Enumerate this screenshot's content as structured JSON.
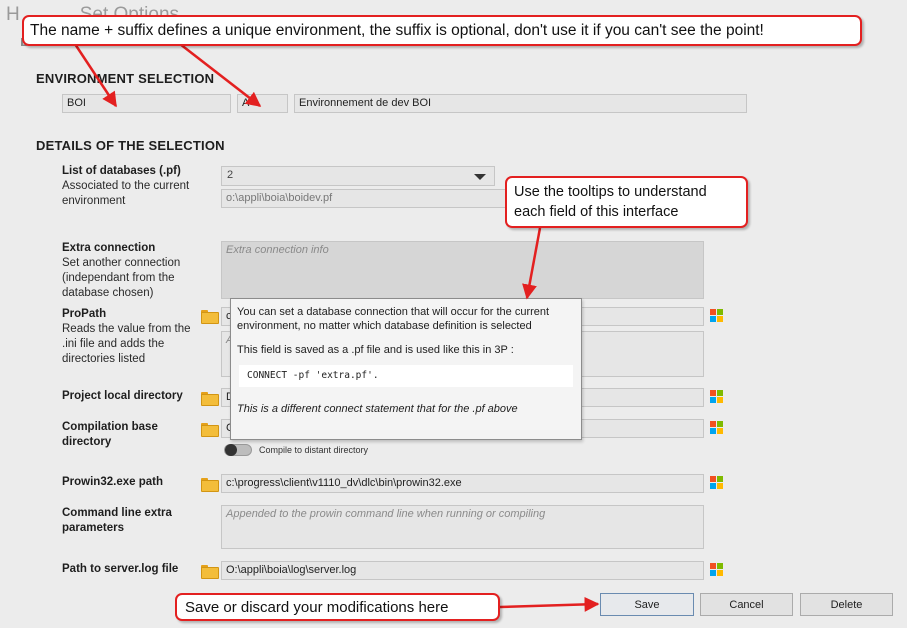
{
  "header": {
    "title": "Set Options",
    "subtitle": "ENVIRONMENT SELECTION"
  },
  "environment_selection": {
    "section_title": "ENVIRONMENT SELECTION",
    "name": "BOI",
    "suffix": "A",
    "label": "Environnement de dev BOI"
  },
  "details": {
    "section_title": "DETAILS OF THE SELECTION",
    "databases": {
      "label": "List of databases (.pf)",
      "description": "Associated to the current environment",
      "selected": "2",
      "path": "o:\\appli\\boia\\boidev.pf"
    },
    "extra_connection": {
      "label": "Extra connection",
      "description": "Set another connection (independant from the database chosen)",
      "placeholder": "Extra connection info"
    },
    "propath": {
      "label": "ProPath",
      "description": "Reads the value from the .ini file and adds the directories listed",
      "value": "c",
      "area_value": "A"
    },
    "project_local_directory": {
      "label": "Project local directory",
      "value": "D"
    },
    "compilation_base_directory": {
      "label": "Compilation base directory",
      "value": "C",
      "toggle_label": "Compile to distant directory"
    },
    "prowin32": {
      "label": "Prowin32.exe path",
      "value": "c:\\progress\\client\\v1110_dv\\dlc\\bin\\prowin32.exe"
    },
    "cmdline": {
      "label": "Command line extra parameters",
      "placeholder": "Appended to the prowin command line when running or compiling"
    },
    "serverlog": {
      "label": "Path to server.log file",
      "value": "O:\\appli\\boia\\log\\server.log"
    }
  },
  "tooltip": {
    "line1": "You can set a database connection that will occur for the current environment, no matter which database definition is selected",
    "line2": "This field is saved as a .pf file and is used like this in 3P :",
    "code": "CONNECT -pf 'extra.pf'.",
    "note": "This is a different connect statement that for the .pf above"
  },
  "buttons": {
    "save": "Save",
    "cancel": "Cancel",
    "delete": "Delete"
  },
  "callouts": {
    "suffix": "The name + suffix defines a unique environment, the suffix is optional, don't use it if you can't see the point!",
    "tooltips": "Use the tooltips to understand each field of this interface",
    "save": "Save or discard your modifications here"
  },
  "colors": {
    "callout_border": "#e32020",
    "arrow": "#e32020",
    "background": "#ececec"
  }
}
